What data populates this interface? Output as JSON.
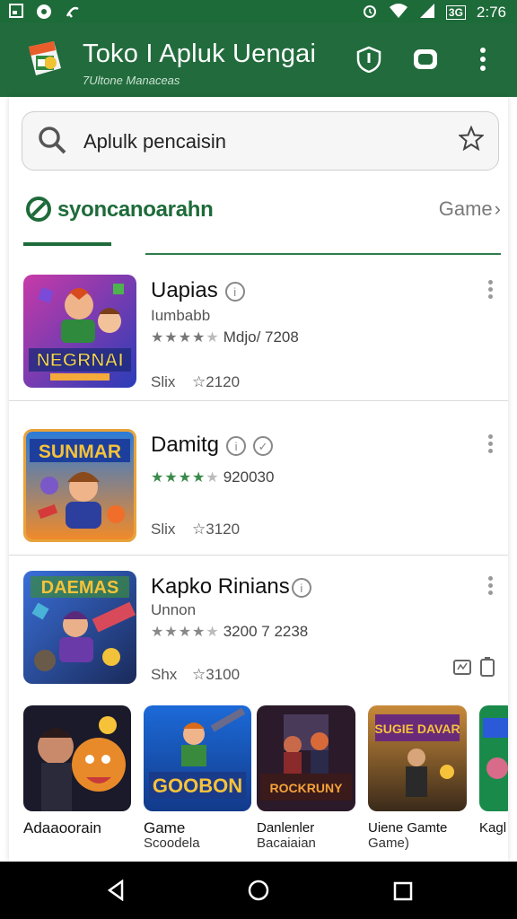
{
  "status_bar": {
    "network_label": "3G",
    "time": "2:76"
  },
  "app_bar": {
    "title": "Toko I Apluk Uengai",
    "subtitle": "7Ultone Manaceas"
  },
  "search": {
    "text": "Aplulk pencaisin"
  },
  "section": {
    "label": "syoncanoarahn",
    "link": "Game"
  },
  "apps": [
    {
      "title": "Uapias",
      "subtitle": "Iumbabb",
      "rating_text": "Mdjo/ 7208",
      "size": "Slix",
      "downloads": "2120"
    },
    {
      "title": "Damitg",
      "subtitle": "",
      "rating_text": "920030",
      "size": "Slix",
      "downloads": "3120"
    },
    {
      "title": "Kapko Rinians",
      "subtitle": "Unnon",
      "rating_text": "3200 7 2238",
      "size": "Shx",
      "downloads": "3100"
    }
  ],
  "cards": [
    {
      "line1": "Adaaoorain",
      "line2": ""
    },
    {
      "line1": "Game",
      "line2": "Scoodela"
    },
    {
      "line1": "Danlenler",
      "line2": "Bacaiaian"
    },
    {
      "line1": "Uiene Gamte",
      "line2": "Game)"
    },
    {
      "line1": "Kagl",
      "line2": ""
    }
  ],
  "thumb_art_text": [
    "NEGRNAI",
    "SUNMAR",
    "DAEMAS"
  ],
  "card_art_text": [
    "",
    "GOOBON",
    "ROCKRUNY",
    "SUGIE DAVAR",
    ""
  ],
  "colors": {
    "primary": "#226b3d",
    "accent": "#1e6b3a",
    "star": "#7a7a7a"
  },
  "icons": [
    "shield-icon",
    "camera-icon",
    "more-vert-icon",
    "search-icon",
    "star-outline-icon",
    "back-icon",
    "home-icon",
    "recents-icon"
  ]
}
